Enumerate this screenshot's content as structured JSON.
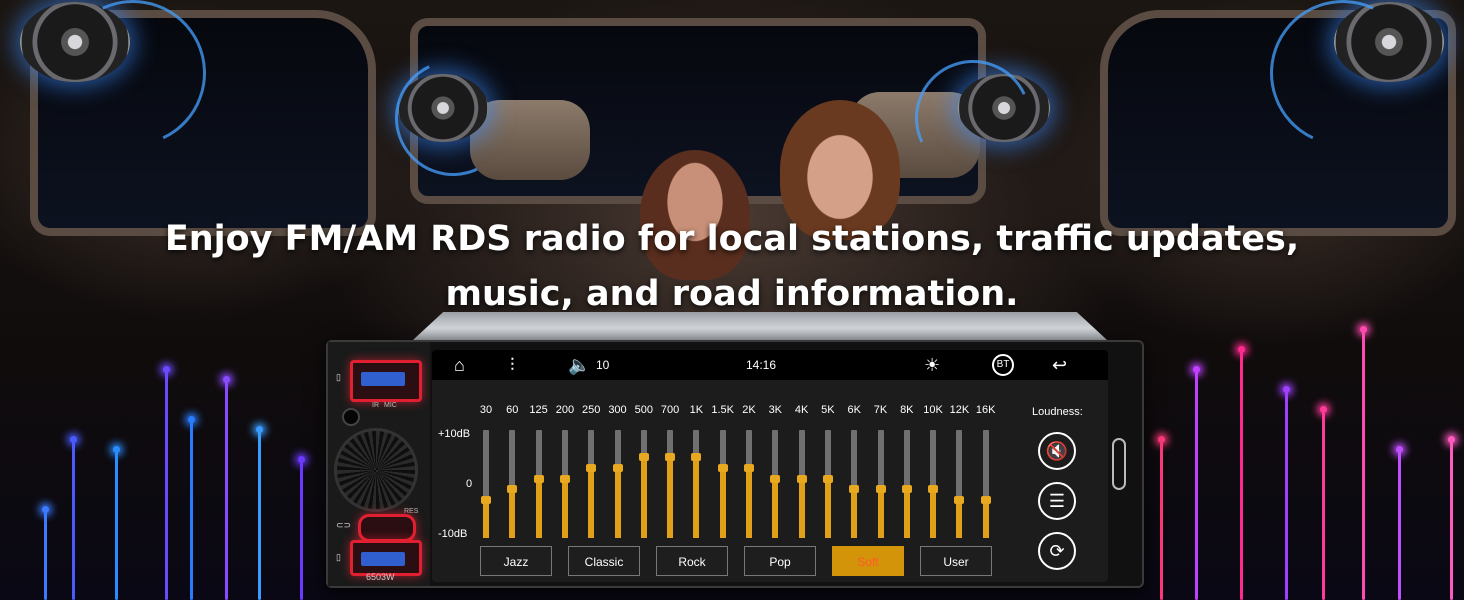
{
  "headline": {
    "line1": "Enjoy FM/AM RDS radio for local stations, traffic updates,",
    "line2": "music, and road information."
  },
  "head_unit": {
    "labels": {
      "ir": "IR",
      "mic": "MIC",
      "res": "RES",
      "model": "6503W"
    },
    "status_bar": {
      "volume": "10",
      "time": "14:16",
      "bt_label": "BT"
    },
    "eq": {
      "frequencies": [
        "30",
        "60",
        "125",
        "200",
        "250",
        "300",
        "500",
        "700",
        "1K",
        "1.5K",
        "2K",
        "3K",
        "4K",
        "5K",
        "6K",
        "7K",
        "8K",
        "10K",
        "12K",
        "16K"
      ],
      "levels_db": [
        -3,
        -1,
        1,
        1,
        3,
        3,
        5,
        5,
        5,
        3,
        3,
        1,
        1,
        1,
        -1,
        -1,
        -1,
        -1,
        -3,
        -3
      ],
      "db_labels": {
        "max": "+10dB",
        "mid": "0",
        "min": "-10dB"
      },
      "range_db": [
        -10,
        10
      ],
      "presets": [
        "Jazz",
        "Classic",
        "Rock",
        "Pop",
        "Soft",
        "User"
      ],
      "active_preset": "Soft",
      "loudness_label": "Loudness:"
    },
    "colors": {
      "slider": "#e0a018",
      "active_preset_bg": "#d4940a",
      "active_preset_text": "#ff5a2a",
      "usb_accent": "#e02030"
    }
  }
}
